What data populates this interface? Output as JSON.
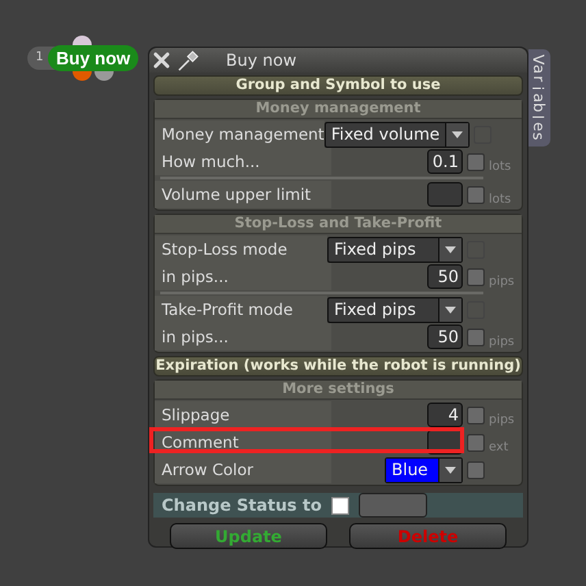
{
  "node": {
    "index": "1",
    "label": "Buy now"
  },
  "dialog": {
    "title": "Buy now",
    "side_tab": "Variables",
    "sections": [
      {
        "kind": "header",
        "title": "Group and Symbol to use"
      },
      {
        "kind": "panel",
        "title": "Money management",
        "groups": [
          [
            {
              "kind": "select",
              "label": "Money management",
              "value": "Fixed volume",
              "checked": false
            },
            {
              "kind": "input",
              "label": "How much...",
              "value": "0.1",
              "unit": "lots",
              "checked": false
            }
          ],
          [
            {
              "kind": "input",
              "label": "Volume upper limit",
              "unit": "lots",
              "checked": false
            }
          ]
        ]
      },
      {
        "kind": "panel",
        "title": "Stop-Loss and Take-Profit",
        "groups": [
          [
            {
              "kind": "select",
              "label": "Stop-Loss mode",
              "value": "Fixed pips",
              "checked": false
            },
            {
              "kind": "input",
              "label": "in pips...",
              "value": "50",
              "unit": "pips",
              "checked": false
            }
          ],
          [
            {
              "kind": "select",
              "label": "Take-Profit mode",
              "value": "Fixed pips",
              "checked": false
            },
            {
              "kind": "input",
              "label": "in pips...",
              "value": "50",
              "unit": "pips",
              "checked": false
            }
          ]
        ]
      },
      {
        "kind": "header",
        "title": "Expiration (works while the robot is running)"
      },
      {
        "kind": "panel",
        "title": "More settings",
        "groups": [
          [
            {
              "kind": "input",
              "label": "Slippage",
              "value": "4",
              "unit": "pips",
              "checked": false
            },
            {
              "kind": "input",
              "label": "Comment",
              "unit": "ext",
              "checked": false,
              "highlighted": true
            },
            {
              "kind": "color-select",
              "label": "Arrow Color",
              "value": "Blue",
              "checked": false
            }
          ]
        ]
      }
    ],
    "status": {
      "label": "Change Status to",
      "checked": false
    },
    "buttons": [
      {
        "label": "Update",
        "color": "#33aa33"
      },
      {
        "label": "Delete",
        "color": "#cc0000"
      }
    ]
  }
}
